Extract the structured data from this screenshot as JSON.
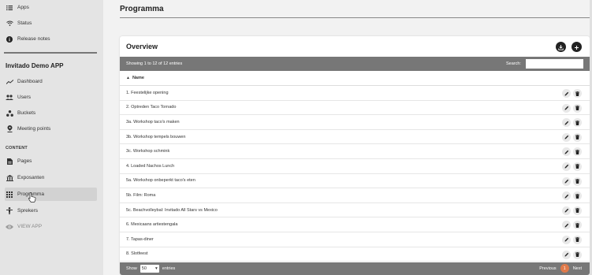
{
  "sidebar": {
    "top_items": [
      {
        "label": "Apps",
        "icon": "list-icon"
      },
      {
        "label": "Status",
        "icon": "wifi-icon"
      },
      {
        "label": "Release notes",
        "icon": "info-icon"
      }
    ],
    "app_title": "Invitado Demo APP",
    "items": [
      {
        "label": "Dashboard",
        "icon": "trend-icon"
      },
      {
        "label": "Users",
        "icon": "users-icon"
      },
      {
        "label": "Buckets",
        "icon": "buckets-icon"
      },
      {
        "label": "Meeting points",
        "icon": "pin-icon"
      }
    ],
    "section_label": "CONTENT",
    "content_items": [
      {
        "label": "Pages",
        "icon": "page-icon"
      },
      {
        "label": "Exposanten",
        "icon": "building-icon"
      },
      {
        "label": "Programma",
        "icon": "grid-icon"
      },
      {
        "label": "Sprekers",
        "icon": "person-icon"
      },
      {
        "label": "VIEW APP",
        "icon": "eye-icon"
      }
    ]
  },
  "page": {
    "title": "Programma"
  },
  "card": {
    "title": "Overview",
    "info": "Showing 1 to 12 of 12 entries",
    "search_label": "Search:",
    "search_value": "",
    "column_header": "Name",
    "rows": [
      "1. Feestelijke opening",
      "2. Optreden Taco Tornado",
      "3a. Workshop taco's maken",
      "3b. Workshop tempels bouwen",
      "3c. Workshop schmink",
      "4. Loaded Nachos Lunch",
      "5a. Workshop onbeperkt taco's eten",
      "5b. Film: Roma",
      "5c. Beachvolleybal: Invitado All Stars vs Mexico",
      "6. Mexicaans artiestengala",
      "7. Tapas-diner",
      "8. Slotfeest"
    ],
    "footer": {
      "show_label": "Show",
      "page_length": "50",
      "entries_label": "entries",
      "previous": "Previous",
      "current_page": "1",
      "next": "Next"
    }
  },
  "colors": {
    "accent": "#e07a4a",
    "bar": "#777777",
    "sidebar_bg": "#e4e4e4"
  }
}
